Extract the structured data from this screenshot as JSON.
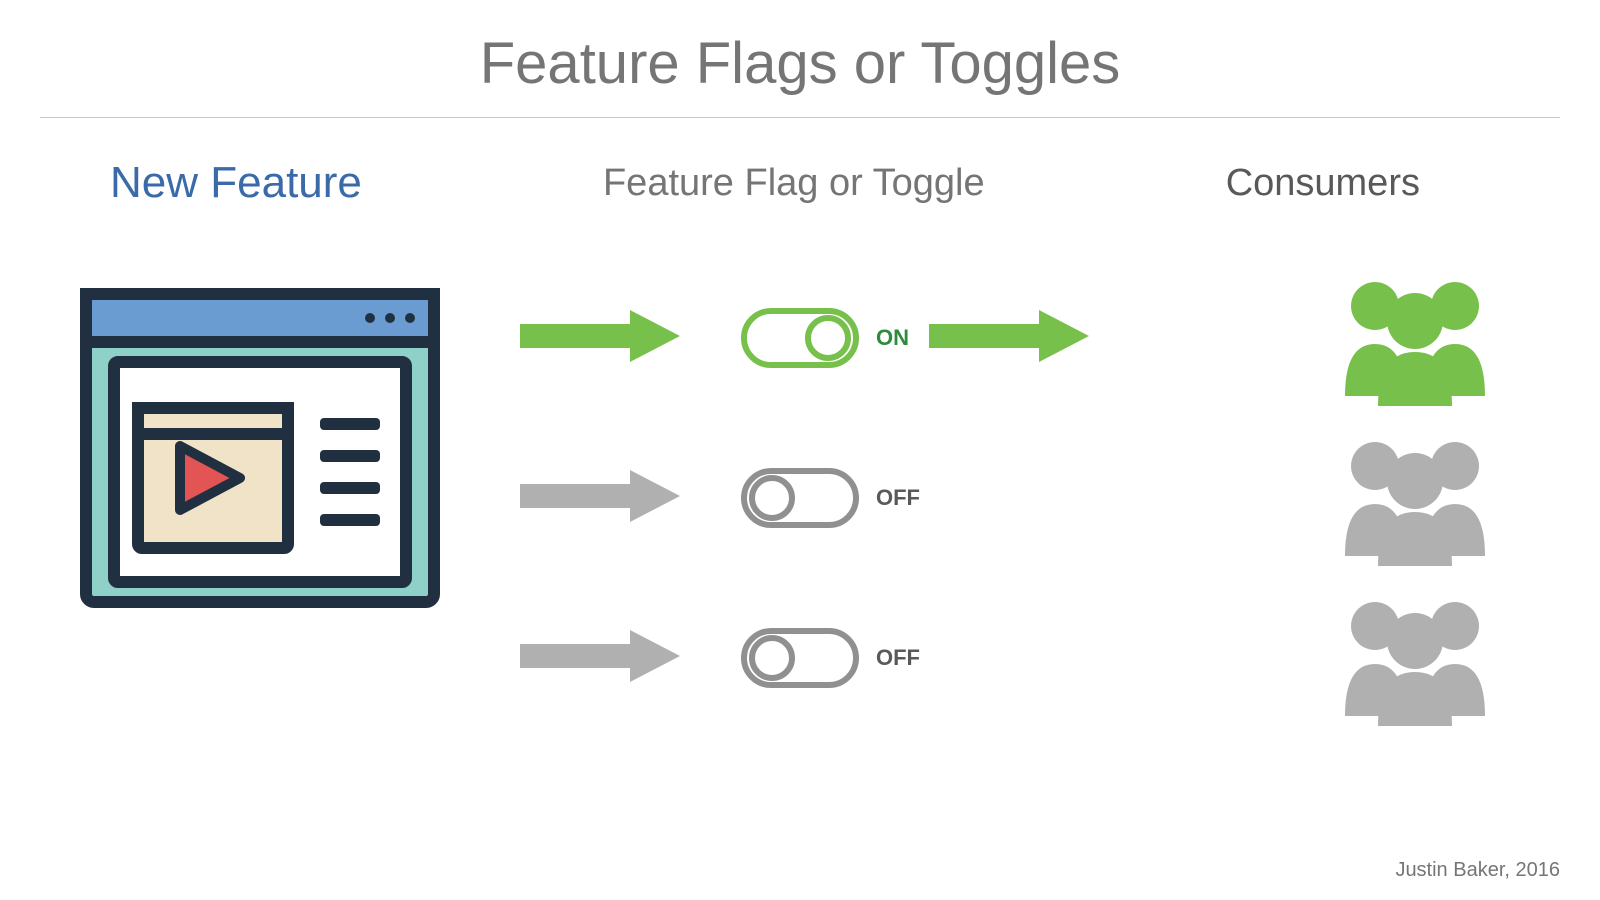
{
  "title": "Feature Flags or Toggles",
  "columns": {
    "left_label": "New Feature",
    "mid_label": "Feature Flag or Toggle",
    "right_label": "Consumers"
  },
  "rows": [
    {
      "state": "on",
      "label": "ON",
      "color": "#78c04c",
      "people_color": "#78c04c"
    },
    {
      "state": "off",
      "label": "OFF",
      "color": "#b0b0b0",
      "people_color": "#b0b0b0"
    },
    {
      "state": "off",
      "label": "OFF",
      "color": "#b0b0b0",
      "people_color": "#b0b0b0"
    }
  ],
  "footer": "Justin Baker, 2016",
  "palette": {
    "green": "#78c04c",
    "gray": "#b0b0b0",
    "title_gray": "#757575",
    "blue_text": "#3a6aa8",
    "outline": "#203040"
  }
}
